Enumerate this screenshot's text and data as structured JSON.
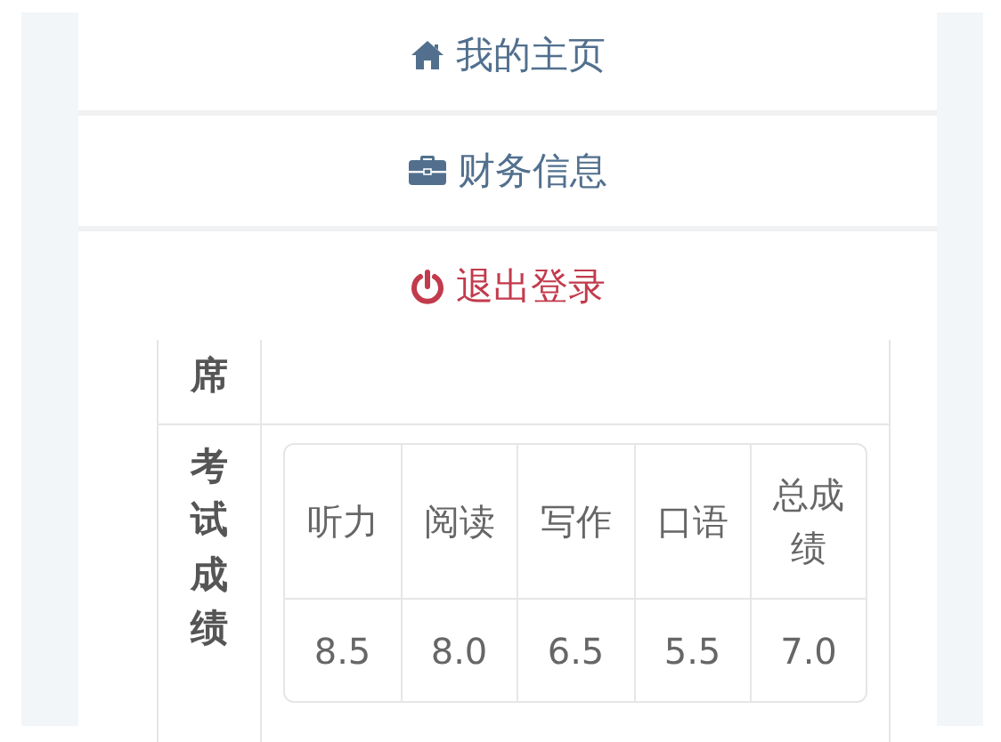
{
  "menu": [
    {
      "kind": "home",
      "label": "我的主页"
    },
    {
      "kind": "finance",
      "label": "财务信息"
    },
    {
      "kind": "logout",
      "label": "退出登录"
    }
  ],
  "table": {
    "rows": [
      {
        "label": "席"
      },
      {
        "label": "考试成绩",
        "scores": {
          "columns": [
            "听力",
            "阅读",
            "写作",
            "口语",
            "总成绩"
          ],
          "values": [
            "8.5",
            "8.0",
            "6.5",
            "5.5",
            "7.0"
          ]
        }
      }
    ]
  }
}
